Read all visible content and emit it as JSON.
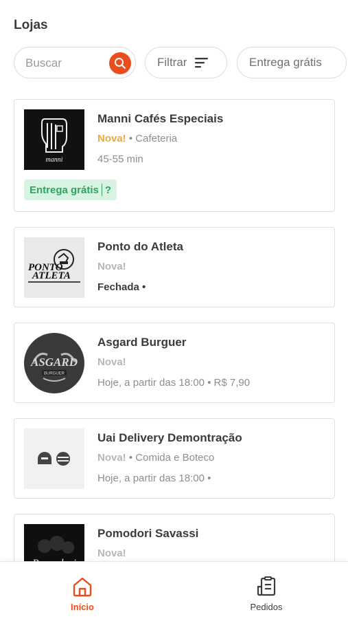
{
  "header": {
    "title": "Lojas"
  },
  "search": {
    "placeholder": "Buscar"
  },
  "filters": {
    "filter_label": "Filtrar",
    "free_delivery_label": "Entrega grátis"
  },
  "stores": [
    {
      "name": "Manni Cafés Especiais",
      "tag": "Nova!",
      "category_text": " • Cafeteria",
      "line3": "45-55 min",
      "badge": "Entrega grátis",
      "badge_help": "?"
    },
    {
      "name": "Ponto do Atleta",
      "tag": "Nova!",
      "line3": "Fechada •"
    },
    {
      "name": "Asgard Burguer",
      "tag": "Nova!",
      "line3": "Hoje, a partir das 18:00 • R$ 7,90"
    },
    {
      "name": "Uai Delivery Demontração",
      "tag": "Nova!",
      "category_text": " • Comida e Boteco",
      "line3": "Hoje, a partir das 18:00 •"
    },
    {
      "name": "Pomodori Savassi",
      "tag": "Nova!"
    }
  ],
  "bottom_nav": [
    {
      "label": "Início",
      "icon": "home-icon",
      "active": true
    },
    {
      "label": "Pedidos",
      "icon": "orders-icon",
      "active": false
    }
  ],
  "colors": {
    "accent": "#ea4d1d",
    "new_tag": "#f2a93b",
    "badge_bg": "#d9f3e3",
    "badge_text": "#2fa45f"
  }
}
